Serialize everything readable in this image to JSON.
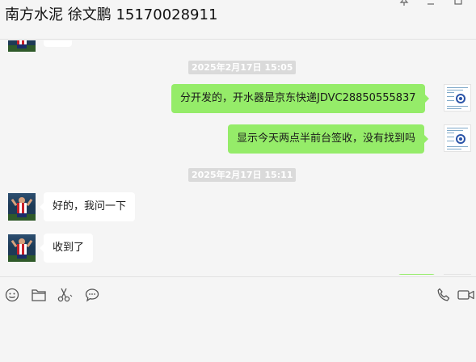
{
  "header": {
    "title": "南方水泥 徐文鹏 15170028911"
  },
  "window_controls": [
    "pin-icon",
    "minimize-icon",
    "maximize-icon"
  ],
  "messages": [
    {
      "type": "time",
      "text": "2025年2月17日 15:05"
    },
    {
      "type": "outgoing",
      "text": "分开发的，开水器是京东快递JDVC28850555837"
    },
    {
      "type": "outgoing",
      "text": "显示今天两点半前台签收，没有找到吗"
    },
    {
      "type": "time",
      "text": "2025年2月17日 15:11"
    },
    {
      "type": "incoming",
      "text": "好的，我问一下"
    },
    {
      "type": "incoming",
      "text": "收到了"
    }
  ],
  "toolbar": {
    "left_icons": [
      "emoji-icon",
      "folder-icon",
      "scissors-icon",
      "chat-bubble-icon"
    ],
    "right_icons": [
      "phone-icon",
      "video-icon"
    ]
  },
  "colors": {
    "outgoing_bubble": "#95ec69",
    "incoming_bubble": "#ffffff",
    "background": "#f5f5f5",
    "timestamp_bg": "#dadada"
  }
}
